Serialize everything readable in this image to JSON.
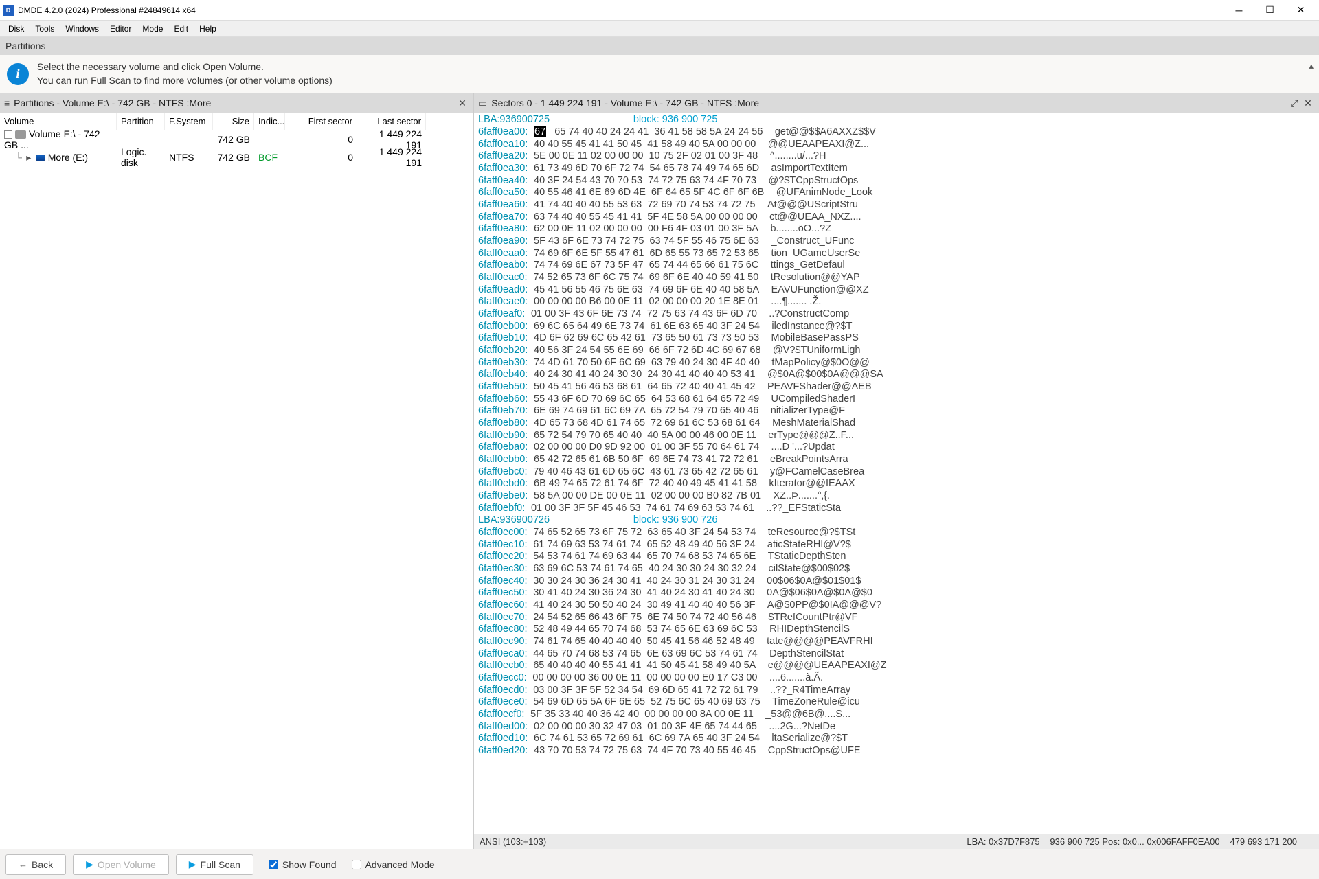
{
  "titlebar": {
    "title": "DMDE 4.2.0 (2024) Professional #24849614 x64"
  },
  "menu": {
    "items": [
      "Disk",
      "Tools",
      "Windows",
      "Editor",
      "Mode",
      "Edit",
      "Help"
    ]
  },
  "context": {
    "label": "Partitions"
  },
  "info": {
    "line1": "Select the necessary volume and click Open Volume.",
    "line2": "You can run Full Scan to find more volumes (or other volume options)"
  },
  "left": {
    "header": "Partitions - Volume E:\\ - 742 GB - NTFS :More",
    "columns": {
      "volume": "Volume",
      "partition": "Partition",
      "fs": "F.System",
      "size": "Size",
      "indic": "Indic...",
      "first": "First sector",
      "last": "Last sector"
    },
    "rows": [
      {
        "indent": 0,
        "checkbox": true,
        "icon": "gray",
        "name": "Volume E:\\ - 742 GB ...",
        "partition": "",
        "fs": "",
        "size": "742 GB",
        "indic": "",
        "first": "0",
        "last": "1 449 224 191"
      },
      {
        "indent": 1,
        "expand": true,
        "icon": "blue",
        "name": "More (E:)",
        "partition": "Logic. disk",
        "fs": "NTFS",
        "size": "742 GB",
        "indic": "BCF",
        "indic_green": true,
        "first": "0",
        "last": "1 449 224 191"
      }
    ]
  },
  "right": {
    "header": "Sectors 0 - 1 449 224 191 - Volume E:\\ - 742 GB - NTFS :More",
    "lba_lines": [
      {
        "lba": "LBA:936900725",
        "block": "block: 936 900 725"
      },
      {
        "lba": "LBA:936900726",
        "block": "block: 936 900 726"
      }
    ],
    "hex_first_highlight": "67",
    "rows": [
      {
        "o": "6faff0ea00:",
        "h": "   65 74 40 40 24 24 41  36 41 58 58 5A 24 24 56",
        "a": "get@@$$A6AXXZ$$V"
      },
      {
        "o": "6faff0ea10:",
        "h": "40 40 55 45 41 41 50 45  41 58 49 40 5A 00 00 00",
        "a": "@@UEAAPEAXI@Z..."
      },
      {
        "o": "6faff0ea20:",
        "h": "5E 00 0E 11 02 00 00 00  10 75 2F 02 01 00 3F 48",
        "a": "^........u/...?H"
      },
      {
        "o": "6faff0ea30:",
        "h": "61 73 49 6D 70 6F 72 74  54 65 78 74 49 74 65 6D",
        "a": "asImportTextItem"
      },
      {
        "o": "6faff0ea40:",
        "h": "40 3F 24 54 43 70 70 53  74 72 75 63 74 4F 70 73",
        "a": "@?$TCppStructOps"
      },
      {
        "o": "6faff0ea50:",
        "h": "40 55 46 41 6E 69 6D 4E  6F 64 65 5F 4C 6F 6F 6B",
        "a": "@UFAnimNode_Look"
      },
      {
        "o": "6faff0ea60:",
        "h": "41 74 40 40 40 55 53 63  72 69 70 74 53 74 72 75",
        "a": "At@@@UScriptStru"
      },
      {
        "o": "6faff0ea70:",
        "h": "63 74 40 40 55 45 41 41  5F 4E 58 5A 00 00 00 00",
        "a": "ct@@UEAA_NXZ...."
      },
      {
        "o": "6faff0ea80:",
        "h": "62 00 0E 11 02 00 00 00  00 F6 4F 03 01 00 3F 5A",
        "a": "b........öO...?Z"
      },
      {
        "o": "6faff0ea90:",
        "h": "5F 43 6F 6E 73 74 72 75  63 74 5F 55 46 75 6E 63",
        "a": "_Construct_UFunc"
      },
      {
        "o": "6faff0eaa0:",
        "h": "74 69 6F 6E 5F 55 47 61  6D 65 55 73 65 72 53 65",
        "a": "tion_UGameUserSe"
      },
      {
        "o": "6faff0eab0:",
        "h": "74 74 69 6E 67 73 5F 47  65 74 44 65 66 61 75 6C",
        "a": "ttings_GetDefaul"
      },
      {
        "o": "6faff0eac0:",
        "h": "74 52 65 73 6F 6C 75 74  69 6F 6E 40 40 59 41 50",
        "a": "tResolution@@YAP"
      },
      {
        "o": "6faff0ead0:",
        "h": "45 41 56 55 46 75 6E 63  74 69 6F 6E 40 40 58 5A",
        "a": "EAVUFunction@@XZ"
      },
      {
        "o": "6faff0eae0:",
        "h": "00 00 00 00 B6 00 0E 11  02 00 00 00 20 1E 8E 01",
        "a": "....¶....... .Ž."
      },
      {
        "o": "6faff0eaf0:",
        "h": "01 00 3F 43 6F 6E 73 74  72 75 63 74 43 6F 6D 70",
        "a": "..?ConstructComp"
      },
      {
        "o": "6faff0eb00:",
        "h": "69 6C 65 64 49 6E 73 74  61 6E 63 65 40 3F 24 54",
        "a": "iledInstance@?$T"
      },
      {
        "o": "6faff0eb10:",
        "h": "4D 6F 62 69 6C 65 42 61  73 65 50 61 73 73 50 53",
        "a": "MobileBasePassPS"
      },
      {
        "o": "6faff0eb20:",
        "h": "40 56 3F 24 54 55 6E 69  66 6F 72 6D 4C 69 67 68",
        "a": "@V?$TUniformLigh"
      },
      {
        "o": "6faff0eb30:",
        "h": "74 4D 61 70 50 6F 6C 69  63 79 40 24 30 4F 40 40",
        "a": "tMapPolicy@$0O@@"
      },
      {
        "o": "6faff0eb40:",
        "h": "40 24 30 41 40 24 30 30  24 30 41 40 40 40 53 41",
        "a": "@$0A@$00$0A@@@SA"
      },
      {
        "o": "6faff0eb50:",
        "h": "50 45 41 56 46 53 68 61  64 65 72 40 40 41 45 42",
        "a": "PEAVFShader@@AEB"
      },
      {
        "o": "6faff0eb60:",
        "h": "55 43 6F 6D 70 69 6C 65  64 53 68 61 64 65 72 49",
        "a": "UCompiledShaderI"
      },
      {
        "o": "6faff0eb70:",
        "h": "6E 69 74 69 61 6C 69 7A  65 72 54 79 70 65 40 46",
        "a": "nitializerType@F"
      },
      {
        "o": "6faff0eb80:",
        "h": "4D 65 73 68 4D 61 74 65  72 69 61 6C 53 68 61 64",
        "a": "MeshMaterialShad"
      },
      {
        "o": "6faff0eb90:",
        "h": "65 72 54 79 70 65 40 40  40 5A 00 00 46 00 0E 11",
        "a": "erType@@@Z..F..."
      },
      {
        "o": "6faff0eba0:",
        "h": "02 00 00 00 D0 9D 92 00  01 00 3F 55 70 64 61 74",
        "a": "....Ð '...?Updat"
      },
      {
        "o": "6faff0ebb0:",
        "h": "65 42 72 65 61 6B 50 6F  69 6E 74 73 41 72 72 61",
        "a": "eBreakPointsArra"
      },
      {
        "o": "6faff0ebc0:",
        "h": "79 40 46 43 61 6D 65 6C  43 61 73 65 42 72 65 61",
        "a": "y@FCamelCaseBrea"
      },
      {
        "o": "6faff0ebd0:",
        "h": "6B 49 74 65 72 61 74 6F  72 40 40 49 45 41 41 58",
        "a": "kIterator@@IEAAX"
      },
      {
        "o": "6faff0ebe0:",
        "h": "58 5A 00 00 DE 00 0E 11  02 00 00 00 B0 82 7B 01",
        "a": "XZ..Þ.......°‚{."
      },
      {
        "o": "6faff0ebf0:",
        "h": "01 00 3F 3F 5F 45 46 53  74 61 74 69 63 53 74 61",
        "a": "..??_EFStaticSta"
      },
      {
        "o": "6faff0ec00:",
        "h": "74 65 52 65 73 6F 75 72  63 65 40 3F 24 54 53 74",
        "a": "teResource@?$TSt"
      },
      {
        "o": "6faff0ec10:",
        "h": "61 74 69 63 53 74 61 74  65 52 48 49 40 56 3F 24",
        "a": "aticStateRHI@V?$"
      },
      {
        "o": "6faff0ec20:",
        "h": "54 53 74 61 74 69 63 44  65 70 74 68 53 74 65 6E",
        "a": "TStaticDepthSten"
      },
      {
        "o": "6faff0ec30:",
        "h": "63 69 6C 53 74 61 74 65  40 24 30 30 24 30 32 24",
        "a": "cilState@$00$02$"
      },
      {
        "o": "6faff0ec40:",
        "h": "30 30 24 30 36 24 30 41  40 24 30 31 24 30 31 24",
        "a": "00$06$0A@$01$01$"
      },
      {
        "o": "6faff0ec50:",
        "h": "30 41 40 24 30 36 24 30  41 40 24 30 41 40 24 30",
        "a": "0A@$06$0A@$0A@$0"
      },
      {
        "o": "6faff0ec60:",
        "h": "41 40 24 30 50 50 40 24  30 49 41 40 40 40 56 3F",
        "a": "A@$0PP@$0IA@@@V?"
      },
      {
        "o": "6faff0ec70:",
        "h": "24 54 52 65 66 43 6F 75  6E 74 50 74 72 40 56 46",
        "a": "$TRefCountPtr@VF"
      },
      {
        "o": "6faff0ec80:",
        "h": "52 48 49 44 65 70 74 68  53 74 65 6E 63 69 6C 53",
        "a": "RHIDepthStencilS"
      },
      {
        "o": "6faff0ec90:",
        "h": "74 61 74 65 40 40 40 40  50 45 41 56 46 52 48 49",
        "a": "tate@@@@PEAVFRHI"
      },
      {
        "o": "6faff0eca0:",
        "h": "44 65 70 74 68 53 74 65  6E 63 69 6C 53 74 61 74",
        "a": "DepthStencilStat"
      },
      {
        "o": "6faff0ecb0:",
        "h": "65 40 40 40 40 55 41 41  41 50 45 41 58 49 40 5A",
        "a": "e@@@@UEAAPEAXI@Z"
      },
      {
        "o": "6faff0ecc0:",
        "h": "00 00 00 00 36 00 0E 11  00 00 00 00 E0 17 C3 00",
        "a": "....6.......à.Ã."
      },
      {
        "o": "6faff0ecd0:",
        "h": "03 00 3F 3F 5F 52 34 54  69 6D 65 41 72 72 61 79",
        "a": "..??_R4TimeArray"
      },
      {
        "o": "6faff0ece0:",
        "h": "54 69 6D 65 5A 6F 6E 65  52 75 6C 65 40 69 63 75",
        "a": "TimeZoneRule@icu"
      },
      {
        "o": "6faff0ecf0:",
        "h": "5F 35 33 40 40 36 42 40  00 00 00 00 8A 00 0E 11",
        "a": "_53@@6B@....S..."
      },
      {
        "o": "6faff0ed00:",
        "h": "02 00 00 00 30 32 47 03  01 00 3F 4E 65 74 44 65",
        "a": "....2G...?NetDe"
      },
      {
        "o": "6faff0ed10:",
        "h": "6C 74 61 53 65 72 69 61  6C 69 7A 65 40 3F 24 54",
        "a": "ltaSerialize@?$T"
      },
      {
        "o": "6faff0ed20:",
        "h": "43 70 70 53 74 72 75 63  74 4F 70 73 40 55 46 45",
        "a": "CppStructOps@UFE"
      }
    ],
    "status": {
      "ansi": "ANSI (103:+103)",
      "lba": "LBA: 0x37D7F875 = 936 900 725   Pos: 0x0...   0x006FAFF0EA00 = 479 693 171 200"
    }
  },
  "bottom": {
    "back": "Back",
    "open": "Open Volume",
    "scan": "Full Scan",
    "showfound": "Show Found",
    "advanced": "Advanced Mode"
  }
}
